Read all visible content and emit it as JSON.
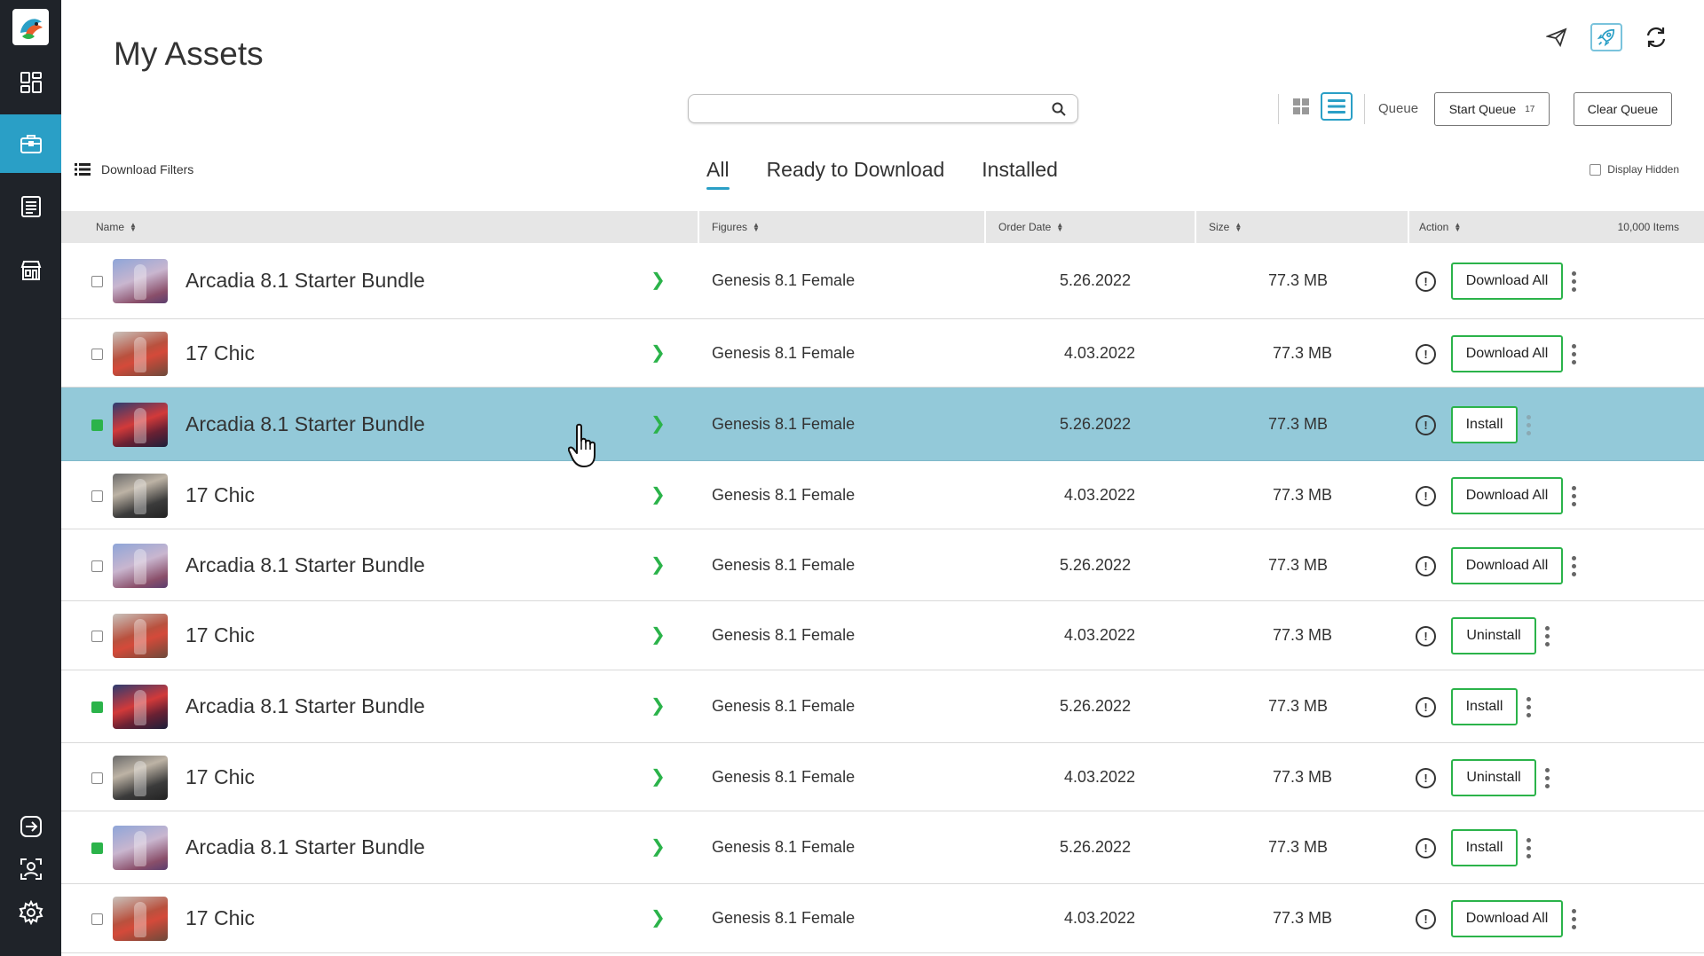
{
  "app": {
    "page_title": "My Assets",
    "accent_color": "#2a9fc6",
    "success_color": "#2bb34a"
  },
  "sidebar": {
    "items": [
      {
        "icon": "dashboard-icon"
      },
      {
        "icon": "briefcase-icon",
        "active": true
      },
      {
        "icon": "list-document-icon"
      },
      {
        "icon": "store-icon"
      },
      {
        "icon": "sign-in-icon"
      },
      {
        "icon": "user-profile-icon"
      },
      {
        "icon": "settings-gear-icon"
      }
    ]
  },
  "header": {
    "icons": [
      "send-icon",
      "rocket-icon",
      "refresh-icon"
    ],
    "search": {
      "placeholder": "",
      "value": ""
    }
  },
  "toolbar": {
    "view_modes": [
      "grid-view-icon",
      "list-view-icon"
    ],
    "active_view": "list",
    "queue_label": "Queue",
    "start_queue_label": "Start Queue",
    "queue_count": "17",
    "clear_queue_label": "Clear Queue"
  },
  "filters": {
    "download_filters_label": "Download Filters",
    "display_hidden_label": "Display Hidden"
  },
  "tabs": [
    {
      "label": "All",
      "active": true
    },
    {
      "label": "Ready to Download",
      "active": false
    },
    {
      "label": "Installed",
      "active": false
    }
  ],
  "table": {
    "columns": {
      "name": "Name",
      "figures": "Figures",
      "order_date": "Order Date",
      "size": "Size",
      "action": "Action"
    },
    "items_count": "10,000 Items",
    "rows": [
      {
        "name": "Arcadia 8.1 Starter Bundle",
        "figure": "Genesis 8.1 Female",
        "date": "5.26.2022",
        "size": "77.3 MB",
        "action": "Download All",
        "checked": false,
        "selected": false
      },
      {
        "name": "17 Chic",
        "figure": "Genesis 8.1 Female",
        "date": "4.03.2022",
        "size": "77.3 MB",
        "action": "Download All",
        "checked": false,
        "selected": false
      },
      {
        "name": "Arcadia 8.1 Starter Bundle",
        "figure": "Genesis 8.1 Female",
        "date": "5.26.2022",
        "size": "77.3 MB",
        "action": "Install",
        "checked": true,
        "selected": true
      },
      {
        "name": "17 Chic",
        "figure": "Genesis 8.1 Female",
        "date": "4.03.2022",
        "size": "77.3 MB",
        "action": "Download All",
        "checked": false,
        "selected": false
      },
      {
        "name": "Arcadia 8.1 Starter Bundle",
        "figure": "Genesis 8.1 Female",
        "date": "5.26.2022",
        "size": "77.3 MB",
        "action": "Download All",
        "checked": false,
        "selected": false
      },
      {
        "name": "17 Chic",
        "figure": "Genesis 8.1 Female",
        "date": "4.03.2022",
        "size": "77.3 MB",
        "action": "Uninstall",
        "checked": false,
        "selected": false
      },
      {
        "name": "Arcadia 8.1 Starter Bundle",
        "figure": "Genesis 8.1 Female",
        "date": "5.26.2022",
        "size": "77.3 MB",
        "action": "Install",
        "checked": true,
        "selected": false
      },
      {
        "name": "17 Chic",
        "figure": "Genesis 8.1 Female",
        "date": "4.03.2022",
        "size": "77.3 MB",
        "action": "Uninstall",
        "checked": false,
        "selected": false
      },
      {
        "name": "Arcadia 8.1 Starter Bundle",
        "figure": "Genesis 8.1 Female",
        "date": "5.26.2022",
        "size": "77.3 MB",
        "action": "Install",
        "checked": true,
        "selected": false
      },
      {
        "name": "17 Chic",
        "figure": "Genesis 8.1 Female",
        "date": "4.03.2022",
        "size": "77.3 MB",
        "action": "Download All",
        "checked": false,
        "selected": false
      }
    ]
  }
}
